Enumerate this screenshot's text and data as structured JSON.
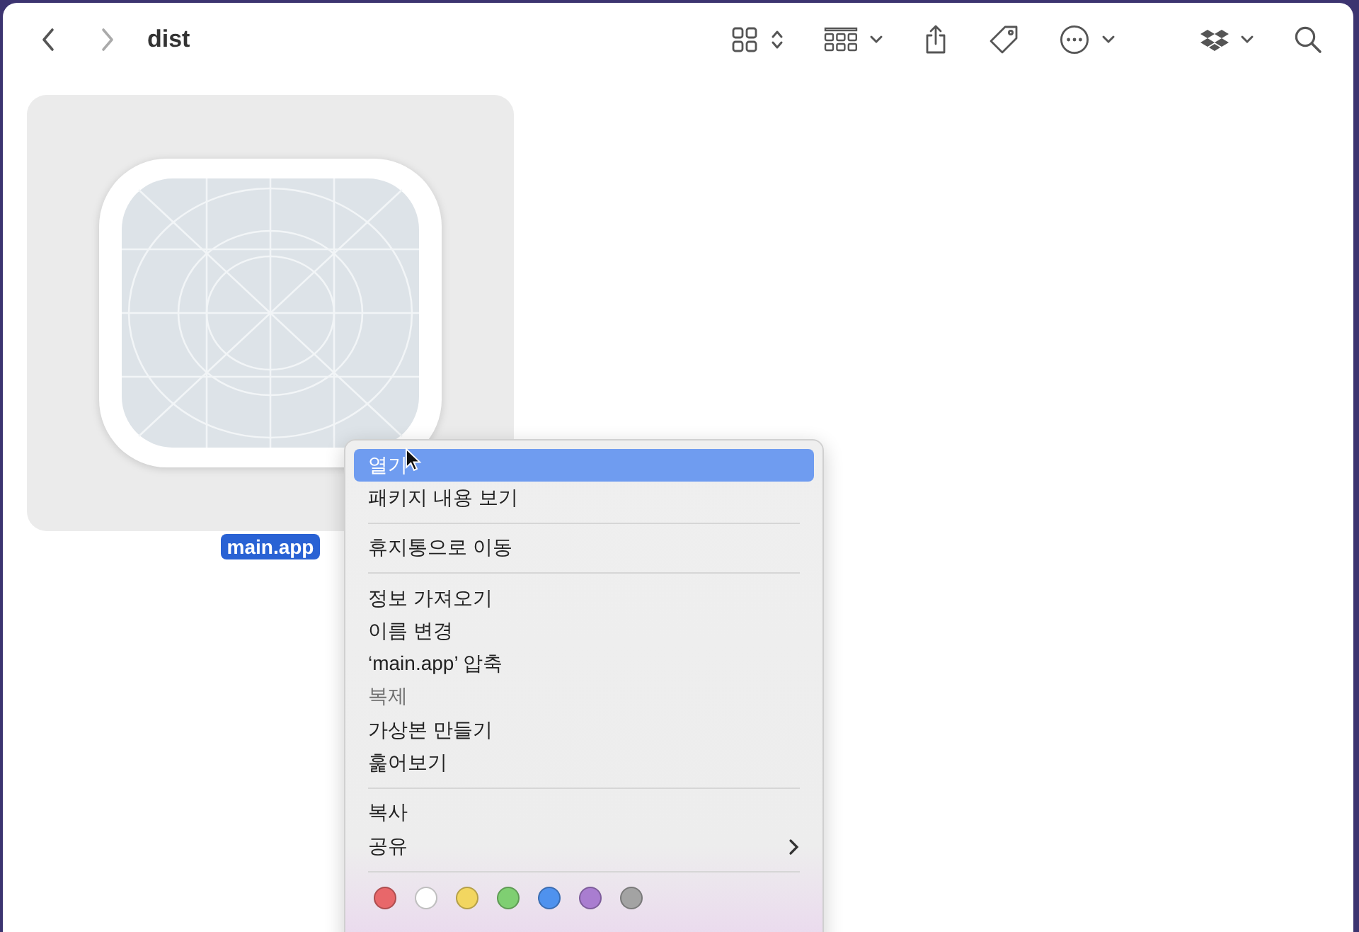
{
  "toolbar": {
    "title": "dist"
  },
  "file": {
    "name": "main.app",
    "selected": true
  },
  "context_menu": {
    "groups": [
      {
        "items": [
          {
            "label": "열기",
            "kind": "plain",
            "selected": true,
            "disabled": false
          },
          {
            "label": "패키지 내용 보기",
            "kind": "plain",
            "selected": false,
            "disabled": false
          }
        ]
      },
      {
        "items": [
          {
            "label": "휴지통으로 이동",
            "kind": "plain",
            "selected": false,
            "disabled": false
          }
        ]
      },
      {
        "items": [
          {
            "label": "정보 가져오기",
            "kind": "plain",
            "selected": false,
            "disabled": false
          },
          {
            "label": "이름 변경",
            "kind": "plain",
            "selected": false,
            "disabled": false
          },
          {
            "label": "‘main.app’ 압축",
            "kind": "plain",
            "selected": false,
            "disabled": false
          },
          {
            "label": "복제",
            "kind": "plain",
            "selected": false,
            "disabled": true
          },
          {
            "label": "가상본 만들기",
            "kind": "plain",
            "selected": false,
            "disabled": false
          },
          {
            "label": "훑어보기",
            "kind": "plain",
            "selected": false,
            "disabled": false
          }
        ]
      },
      {
        "items": [
          {
            "label": "복사",
            "kind": "plain",
            "selected": false,
            "disabled": false
          },
          {
            "label": "공유",
            "kind": "submenu",
            "selected": false,
            "disabled": false
          }
        ]
      }
    ],
    "tags": [
      {
        "color": "#e8676a"
      },
      {
        "color": "#ffffff"
      },
      {
        "color": "#f2d660"
      },
      {
        "color": "#7fcf72"
      },
      {
        "color": "#4f92ee"
      },
      {
        "color": "#a97dd0"
      },
      {
        "color": "#a3a3a3"
      }
    ]
  }
}
